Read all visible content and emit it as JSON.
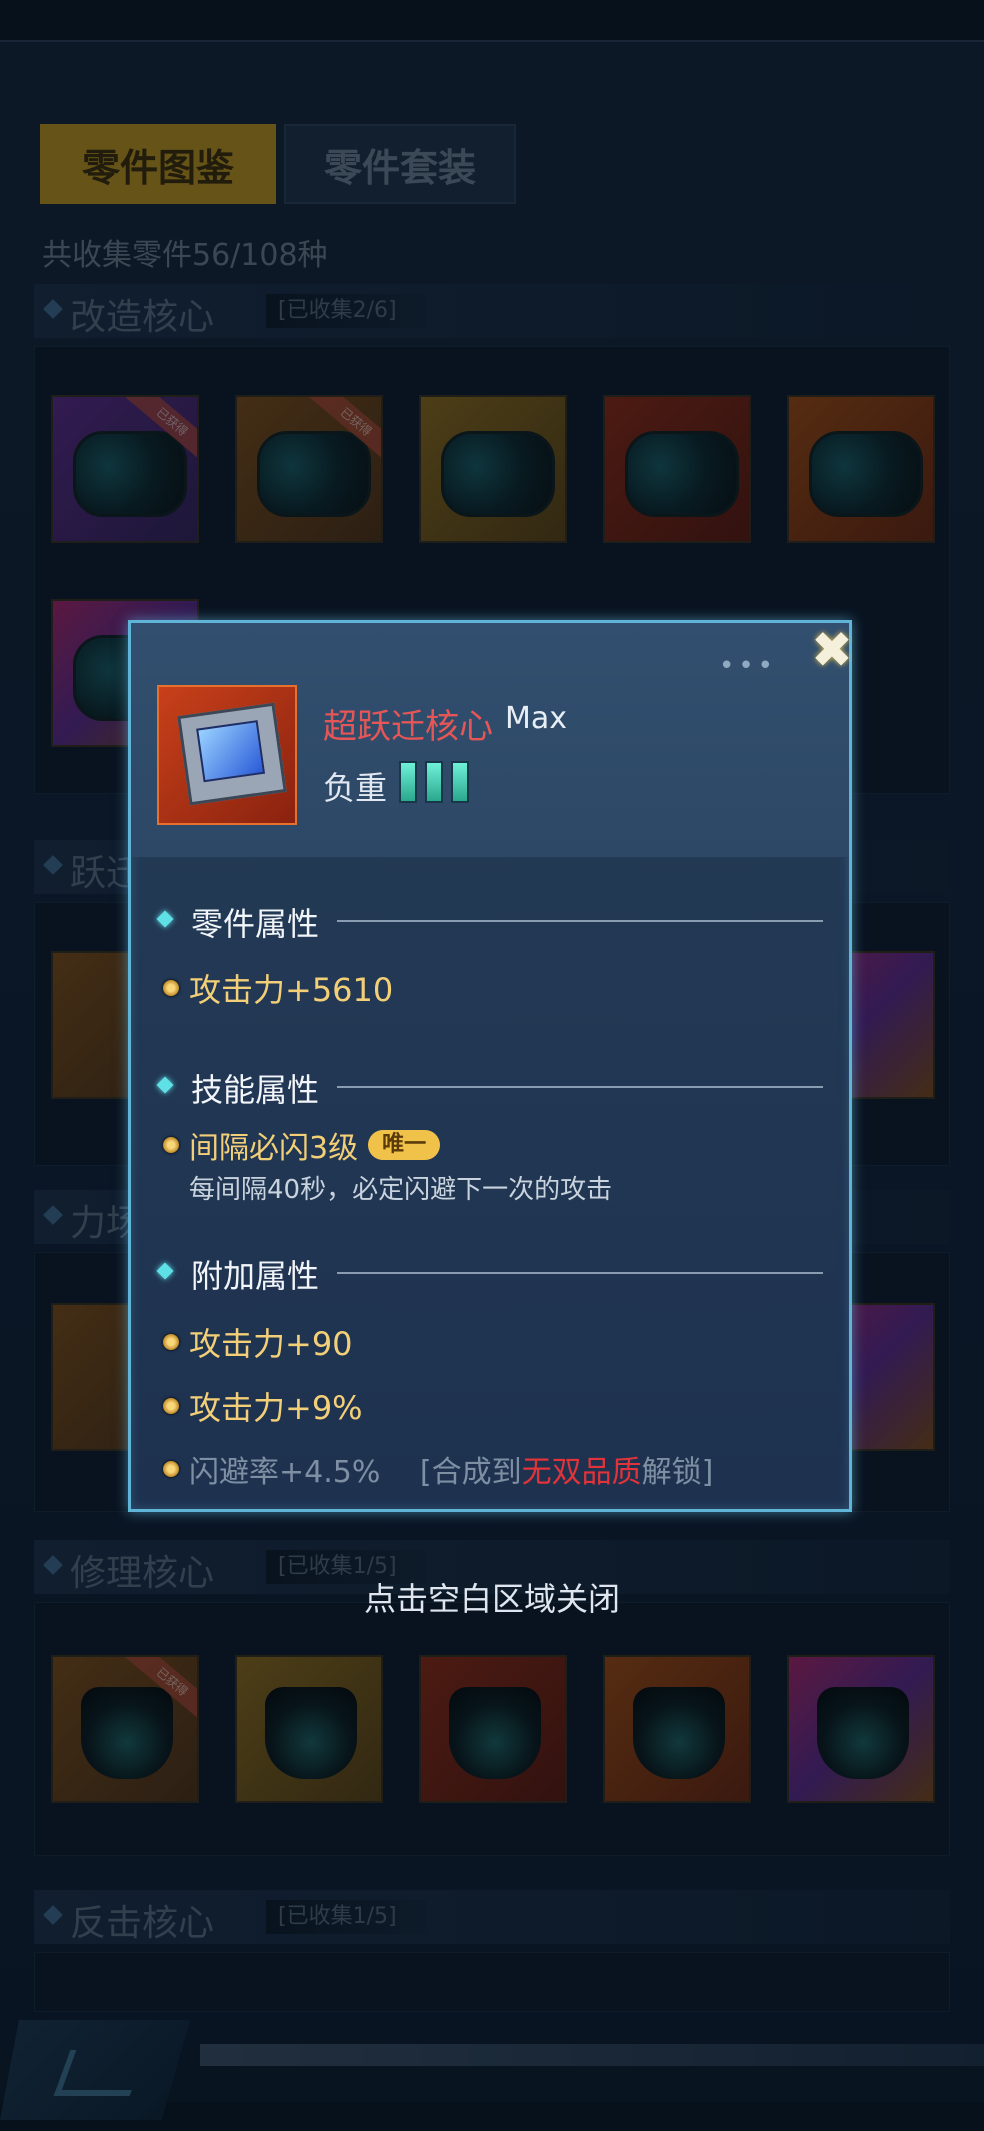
{
  "tabs": [
    {
      "label": "零件图鉴",
      "active": true
    },
    {
      "label": "零件套装",
      "active": false
    }
  ],
  "collection_total": "共收集零件56/108种",
  "categories": [
    {
      "title": "改造核心",
      "count": "[已收集2/6]"
    },
    {
      "title": "跃迁核心",
      "count": ""
    },
    {
      "title": "力场核心",
      "count": ""
    },
    {
      "title": "修理核心",
      "count": "[已收集1/5]"
    },
    {
      "title": "反击核心",
      "count": "[已收集1/5]"
    }
  ],
  "obtained_ribbon": "已获得",
  "close_hint": "点击空白区域关闭",
  "popup": {
    "dots": "•••",
    "close_symbol": "✖",
    "part_name": "超跃迁核心",
    "part_level": "Max",
    "weight_label": "负重",
    "weight_bars": 3,
    "sections": {
      "part_attr": "零件属性",
      "skill_attr": "技能属性",
      "extra_attr": "附加属性"
    },
    "part_stats": [
      "攻击力+5610"
    ],
    "skill": {
      "name": "间隔必闪3级",
      "badge": "唯一",
      "desc": "每间隔40秒，必定闪避下一次的攻击"
    },
    "extra_stats": [
      "攻击力+90",
      "攻击力+9%"
    ],
    "locked_stat": {
      "text": "闪避率+4.5%",
      "hint_prefix": "[合成到",
      "hint_quality": "无双品质",
      "hint_suffix": "解锁]"
    }
  },
  "colors": {
    "accent_border": "#5fb4d8",
    "part_name": "#e65656",
    "stat_gold": "#f3cf78",
    "quality_red": "#e0333a"
  }
}
